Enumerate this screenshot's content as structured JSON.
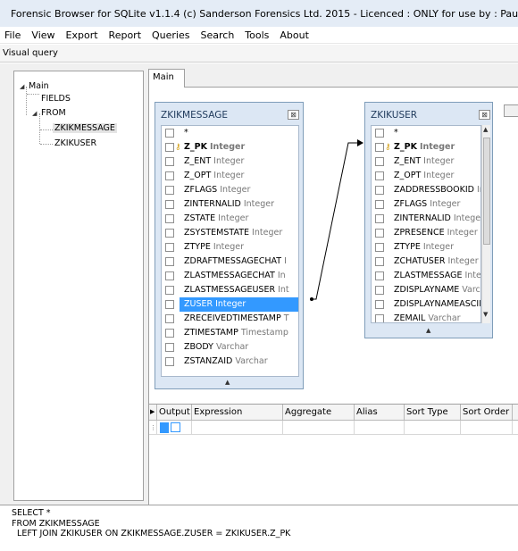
{
  "window": {
    "title": "Forensic Browser for SQLite v1.1.4 (c) Sanderson Forensics Ltd. 2015 - Licenced : ONLY for use by : Paul"
  },
  "menu": [
    "File",
    "View",
    "Export",
    "Report",
    "Queries",
    "Search",
    "Tools",
    "About"
  ],
  "panel_label": "Visual query",
  "tree": {
    "root": "Main",
    "fields": "FIELDS",
    "from": "FROM",
    "tables": [
      "ZKIKMESSAGE",
      "ZKIKUSER"
    ]
  },
  "tab_label": "Main",
  "tables": {
    "message": {
      "name": "ZKIKMESSAGE",
      "close": "⊠",
      "fields": [
        {
          "name": "*",
          "type": ""
        },
        {
          "name": "Z_PK",
          "type": "Integer",
          "pk": true
        },
        {
          "name": "Z_ENT",
          "type": "Integer"
        },
        {
          "name": "Z_OPT",
          "type": "Integer"
        },
        {
          "name": "ZFLAGS",
          "type": "Integer"
        },
        {
          "name": "ZINTERNALID",
          "type": "Integer"
        },
        {
          "name": "ZSTATE",
          "type": "Integer"
        },
        {
          "name": "ZSYSTEMSTATE",
          "type": "Integer"
        },
        {
          "name": "ZTYPE",
          "type": "Integer"
        },
        {
          "name": "ZDRAFTMESSAGECHAT",
          "type": "I"
        },
        {
          "name": "ZLASTMESSAGECHAT",
          "type": "In"
        },
        {
          "name": "ZLASTMESSAGEUSER",
          "type": "Int"
        },
        {
          "name": "ZUSER",
          "type": "Integer",
          "highlighted": true
        },
        {
          "name": "ZRECEIVEDTIMESTAMP",
          "type": "T"
        },
        {
          "name": "ZTIMESTAMP",
          "type": "Timestamp"
        },
        {
          "name": "ZBODY",
          "type": "Varchar"
        },
        {
          "name": "ZSTANZAID",
          "type": "Varchar"
        }
      ]
    },
    "user": {
      "name": "ZKIKUSER",
      "close": "⊠",
      "fields": [
        {
          "name": "*",
          "type": ""
        },
        {
          "name": "Z_PK",
          "type": "Integer",
          "pk": true
        },
        {
          "name": "Z_ENT",
          "type": "Integer"
        },
        {
          "name": "Z_OPT",
          "type": "Integer"
        },
        {
          "name": "ZADDRESSBOOKID",
          "type": "Ir"
        },
        {
          "name": "ZFLAGS",
          "type": "Integer"
        },
        {
          "name": "ZINTERNALID",
          "type": "Intege"
        },
        {
          "name": "ZPRESENCE",
          "type": "Integer"
        },
        {
          "name": "ZTYPE",
          "type": "Integer"
        },
        {
          "name": "ZCHATUSER",
          "type": "Integer"
        },
        {
          "name": "ZLASTMESSAGE",
          "type": "Intege"
        },
        {
          "name": "ZDISPLAYNAME",
          "type": "Varcl"
        },
        {
          "name": "ZDISPLAYNAMEASCII",
          "type": ""
        },
        {
          "name": "ZEMAIL",
          "type": "Varchar"
        }
      ]
    }
  },
  "grid": {
    "columns": [
      "Output",
      "Expression",
      "Aggregate",
      "Alias",
      "Sort Type",
      "Sort Order"
    ]
  },
  "sql_lines": [
    "SELECT *",
    "FROM ZKIKMESSAGE",
    "  LEFT JOIN ZKIKUSER ON ZKIKMESSAGE.ZUSER = ZKIKUSER.Z_PK"
  ],
  "colors": {
    "table_bg": "#dce7f4",
    "highlight": "#3399ff",
    "title_bar": "#e4ecf6"
  }
}
